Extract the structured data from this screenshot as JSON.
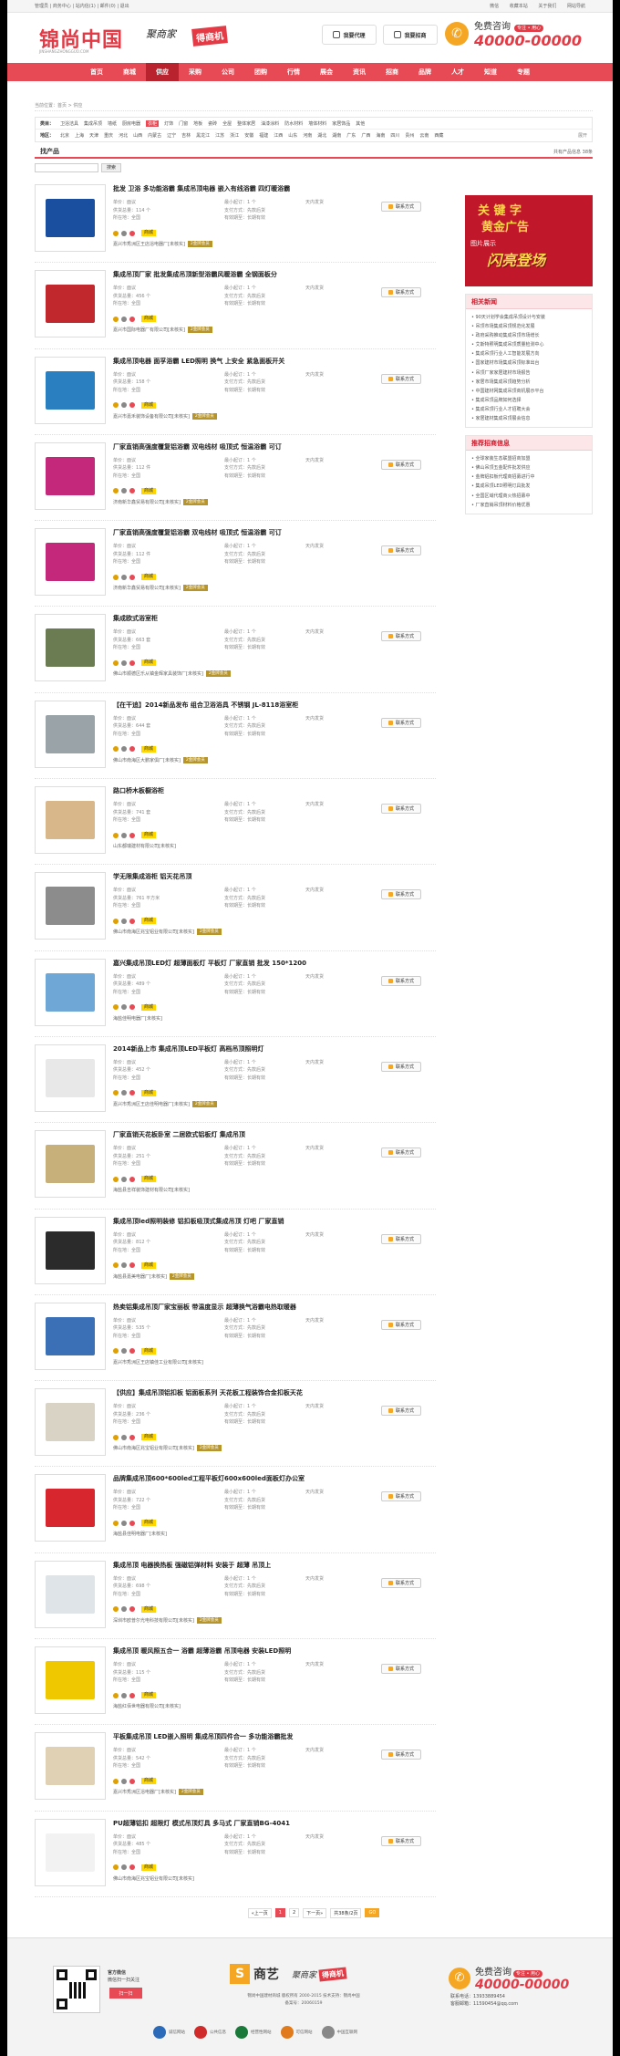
{
  "topbar": {
    "left": "管理员 | 商务中心 | 站内信(1) | 邮件(0) | 退出",
    "right": [
      "微信",
      "收藏本站",
      "关于我们",
      "网站导航"
    ]
  },
  "header": {
    "logo": "锦尚中国",
    "logo_sub": "JINSHANGZHONGGUO.COM",
    "slogan_a": "聚商家",
    "slogan_b": "得商机",
    "btn_buy": "我要代理",
    "btn_sell": "我要招商",
    "hotline_label": "免费咨询",
    "hotline_tag": "专注 • 用心",
    "hotline_number": "40000-00000"
  },
  "nav": [
    {
      "label": "首页",
      "active": false
    },
    {
      "label": "商城",
      "active": false
    },
    {
      "label": "供应",
      "active": true
    },
    {
      "label": "采购",
      "active": false
    },
    {
      "label": "公司",
      "active": false
    },
    {
      "label": "团购",
      "active": false
    },
    {
      "label": "行情",
      "active": false
    },
    {
      "label": "展会",
      "active": false
    },
    {
      "label": "资讯",
      "active": false
    },
    {
      "label": "招商",
      "active": false
    },
    {
      "label": "品牌",
      "active": false
    },
    {
      "label": "人才",
      "active": false
    },
    {
      "label": "知道",
      "active": false
    },
    {
      "label": "专题",
      "active": false
    }
  ],
  "breadcrumb": "当前位置：首页 > 供应",
  "filter": {
    "category_label": "类目：",
    "categories": [
      "卫浴洁具",
      "集成吊顶",
      "墙纸",
      "厨房电器",
      "衣柜",
      "灯饰",
      "门窗",
      "地板",
      "瓷砖",
      "全屋",
      "整体家居",
      "油漆涂料",
      "防水材料",
      "墙体材料",
      "家居饰品",
      "其他"
    ],
    "active_category": "衣柜",
    "region_label": "地区：",
    "regions": [
      "北京",
      "上海",
      "天津",
      "重庆",
      "河北",
      "山西",
      "内蒙古",
      "辽宁",
      "吉林",
      "黑龙江",
      "江苏",
      "浙江",
      "安徽",
      "福建",
      "江西",
      "山东",
      "河南",
      "湖北",
      "湖南",
      "广东",
      "广西",
      "海南",
      "四川",
      "贵州",
      "云南",
      "西藏"
    ],
    "more": "展开"
  },
  "results": {
    "tab": "找产品",
    "count": "共有产品信息 38条",
    "search_button": "搜索"
  },
  "labels": {
    "price": "单价：面议",
    "min_order": "最小起订：1 个",
    "region": "所在地：全国",
    "supply": "供货总量：",
    "payment": "支付方式：先款后货",
    "ship": "发货期限：自买家付款之日起",
    "ship2": "天内发货",
    "valid": "有效期至：长期有效",
    "contact": "联系方式",
    "badge": "商城",
    "vip": "2金牌会员"
  },
  "products": [
    {
      "title": "批发 卫浴 多功能浴霸 集成吊顶电器 嵌入有线浴霸 四灯暖浴霸",
      "supply": "114 个",
      "company": "嘉兴市秀洲区王店浴电器厂[未核实]",
      "color": "#1a4fa0"
    },
    {
      "title": "集成吊顶厂家 批发集成吊顶新型浴霸风暖浴霸 全钢面板分",
      "supply": "456 个",
      "company": "嘉兴市国际电器厂有限公司[未核实]",
      "color": "#c0282e"
    },
    {
      "title": "集成吊顶电器 面孚浴霸 LED照明 换气 上安全 紧急面板开关",
      "supply": "158 个",
      "company": "嘉兴市嘉禾装饰设备有限公司[未核实]",
      "color": "#2a7fc0"
    },
    {
      "title": "厂家直销高强度覆复铝浴霸 双电线材 吸顶式 恒温浴霸 可订",
      "supply": "112 件",
      "company": "济南新华鑫贸易有限公司[未核实]",
      "color": "#c4287a"
    },
    {
      "title": "厂家直销高强度覆复铝浴霸 双电线材 吸顶式 恒温浴霸 可订",
      "supply": "112 件",
      "company": "济南新华鑫贸易有限公司[未核实]",
      "color": "#c4287a"
    },
    {
      "title": "集成欧式浴室柜",
      "supply": "663 套",
      "company": "佛山市顺德区乐从镇金辉家具装饰厂[未核实]",
      "color": "#6b7b52"
    },
    {
      "title": "【在干追】2014新品发布 组合卫浴浴具 不锈钢 JL-8118浴室柜",
      "supply": "644 套",
      "company": "佛山市南海区大鹏家俱厂[未核实]",
      "color": "#9aa3a8"
    },
    {
      "title": "路口桥木板橱浴柜",
      "supply": "741 套",
      "company": "山东都瑞建材有限公司[未核实]",
      "color": "#d8b78a"
    },
    {
      "title": "学无限集成浴柜 铝天花吊顶",
      "supply": "761 平方米",
      "company": "佛山市南海区兆宝铝业有限公司[未核实]",
      "color": "#8c8c8c"
    },
    {
      "title": "嘉兴集成吊顶LED灯 超薄面板灯 平板灯 厂家直销 批发 150*1200",
      "supply": "489 个",
      "company": "海盐佳明电器厂[未核实]",
      "color": "#6fa8d6"
    },
    {
      "title": "2014新品上市 集成吊顶LED平板灯 高档吊顶照明灯",
      "supply": "452 个",
      "company": "嘉兴市秀洲区王店佳明电器厂[未核实]",
      "color": "#e8e8e8"
    },
    {
      "title": "厂家直销天花板卧室 二居欧式铝板灯 集成吊顶",
      "supply": "251 个",
      "company": "海盐县吉祥装饰建材有限公司[未核实]",
      "color": "#c8b07a"
    },
    {
      "title": "集成吊顶led照明装修 铝扣板吸顶式集成吊顶 灯吧 厂家直销",
      "supply": "812 个",
      "company": "海盐县嘉美电器厂[未核实]",
      "color": "#2b2b2b"
    },
    {
      "title": "热卖铝集成吊顶厂家宝丽板 带温度显示 超薄换气浴霸电热取暖器",
      "supply": "535 个",
      "company": "嘉兴市秀洲区王店镇佳工业有限公司[未核实]",
      "color": "#3b6fb6"
    },
    {
      "title": "【供应】集成吊顶铝扣板 铝面板系列 天花板工程装饰合金扣板天花",
      "supply": "236 个",
      "company": "佛山市南海区兆宝铝业有限公司[未核实]",
      "color": "#d9d3c6"
    },
    {
      "title": "品牌集成吊顶600*600led工程平板灯600x600led面板灯办公室",
      "supply": "722 个",
      "company": "海盐县佳明电器厂[未核实]",
      "color": "#d8262e"
    },
    {
      "title": "集成吊顶 电器换热板 强磁铝弹材料 安装于 超薄 吊顶上",
      "supply": "698 个",
      "company": "深圳市欧普尔光电科技有限公司[未核实]",
      "color": "#dfe4e8"
    },
    {
      "title": "集成吊顶 暖风照五合一 浴霸 超薄浴霸 吊顶电器 安装LED照明",
      "supply": "115 个",
      "company": "海盐红佰世电器有限公司[未核实]",
      "color": "#f0c800"
    },
    {
      "title": "平板集成吊顶 LED嵌入照明 集成吊顶四件合一 多功能浴霸批发",
      "supply": "542 个",
      "company": "嘉兴市秀洲区浴电器厂[未核实]",
      "color": "#e0d0b4"
    },
    {
      "title": "PU超薄铝扣 超限灯 模式吊顶灯具 多马式 厂家直销BG-4041",
      "supply": "485 个",
      "company": "佛山市南海区兆宝铝业有限公司[未核实]",
      "color": "#f2f2f2"
    }
  ],
  "pager": {
    "prev": "«上一页",
    "pages": [
      "1",
      "2"
    ],
    "next": "下一页»",
    "total": "共38条/2页",
    "go": "GO"
  },
  "sidebar": {
    "ad": {
      "l1": "关 键 字",
      "l2": "黄金广告",
      "l3": "图片展示",
      "l4": "闪亮登场"
    },
    "hot_title": "相关新闻",
    "hot": [
      "• 90天计划学会集成吊顶设计与安装",
      "• 吊顶市场集成吊顶规范化发展",
      "• 政府采购推动集成吊顶市场增长",
      "• 艾斯特照明集成吊顶质量检测中心",
      "• 集成吊顶行业人工智能发展方向",
      "• 国家建材市场集成吊顶标准出台",
      "• 吊顶厂家家居建材市场报告",
      "• 家居市场集成吊顶趋势分析",
      "• 中国建材网集成吊顶商机展示平台",
      "• 集成吊顶品牌如何选择",
      "• 集成吊顶行业人才招聘大会",
      "• 家居建材集成吊顶展会信息"
    ],
    "ent_title": "推荐招商信息",
    "ent": [
      "• 全球家装生态联盟招商加盟",
      "• 佛山吊顶五金配件批发供应",
      "• 金牌铝扣板代理商招募进行中",
      "• 集成吊顶LED照明灯具批发",
      "• 全国区域代理商火热招募中",
      "• 厂家直销吊顶材料价格优惠"
    ]
  },
  "footer": {
    "qr_title": "官方微信",
    "qr_sub": "微信扫一扫关注",
    "qr_btn": "扫一扫",
    "brand": "商艺",
    "slogan_a": "聚商家",
    "slogan_b": "得商机",
    "copy1": "锦尚中国建材商城 版权所有 2000-2015 技术支持：锦尚中国",
    "copy2": "备案号：20060159",
    "hotline_label": "免费咨询",
    "hotline_tag": "专注 • 用心",
    "hotline_number": "40000-00000",
    "service1": "联系电话：13933889454",
    "service2": "客服邮箱：11590454@qq.com",
    "badges": [
      "诚信网站",
      "公共信息",
      "经营性网站",
      "可信网站",
      "中国互联网"
    ]
  }
}
